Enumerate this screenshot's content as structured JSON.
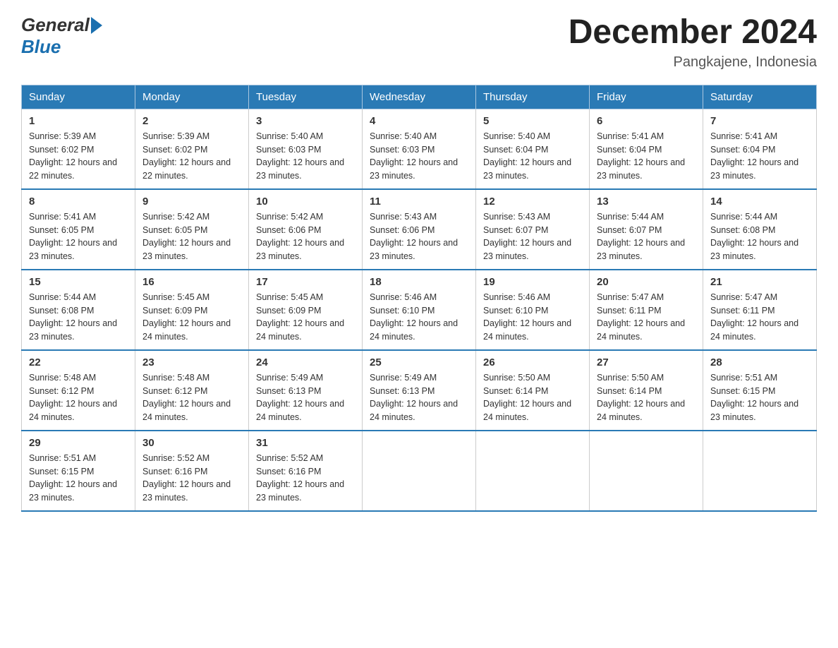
{
  "header": {
    "month_title": "December 2024",
    "location": "Pangkajene, Indonesia"
  },
  "logo": {
    "general": "General",
    "blue": "Blue"
  },
  "columns": [
    "Sunday",
    "Monday",
    "Tuesday",
    "Wednesday",
    "Thursday",
    "Friday",
    "Saturday"
  ],
  "weeks": [
    [
      {
        "day": "1",
        "sunrise": "Sunrise: 5:39 AM",
        "sunset": "Sunset: 6:02 PM",
        "daylight": "Daylight: 12 hours and 22 minutes."
      },
      {
        "day": "2",
        "sunrise": "Sunrise: 5:39 AM",
        "sunset": "Sunset: 6:02 PM",
        "daylight": "Daylight: 12 hours and 22 minutes."
      },
      {
        "day": "3",
        "sunrise": "Sunrise: 5:40 AM",
        "sunset": "Sunset: 6:03 PM",
        "daylight": "Daylight: 12 hours and 23 minutes."
      },
      {
        "day": "4",
        "sunrise": "Sunrise: 5:40 AM",
        "sunset": "Sunset: 6:03 PM",
        "daylight": "Daylight: 12 hours and 23 minutes."
      },
      {
        "day": "5",
        "sunrise": "Sunrise: 5:40 AM",
        "sunset": "Sunset: 6:04 PM",
        "daylight": "Daylight: 12 hours and 23 minutes."
      },
      {
        "day": "6",
        "sunrise": "Sunrise: 5:41 AM",
        "sunset": "Sunset: 6:04 PM",
        "daylight": "Daylight: 12 hours and 23 minutes."
      },
      {
        "day": "7",
        "sunrise": "Sunrise: 5:41 AM",
        "sunset": "Sunset: 6:04 PM",
        "daylight": "Daylight: 12 hours and 23 minutes."
      }
    ],
    [
      {
        "day": "8",
        "sunrise": "Sunrise: 5:41 AM",
        "sunset": "Sunset: 6:05 PM",
        "daylight": "Daylight: 12 hours and 23 minutes."
      },
      {
        "day": "9",
        "sunrise": "Sunrise: 5:42 AM",
        "sunset": "Sunset: 6:05 PM",
        "daylight": "Daylight: 12 hours and 23 minutes."
      },
      {
        "day": "10",
        "sunrise": "Sunrise: 5:42 AM",
        "sunset": "Sunset: 6:06 PM",
        "daylight": "Daylight: 12 hours and 23 minutes."
      },
      {
        "day": "11",
        "sunrise": "Sunrise: 5:43 AM",
        "sunset": "Sunset: 6:06 PM",
        "daylight": "Daylight: 12 hours and 23 minutes."
      },
      {
        "day": "12",
        "sunrise": "Sunrise: 5:43 AM",
        "sunset": "Sunset: 6:07 PM",
        "daylight": "Daylight: 12 hours and 23 minutes."
      },
      {
        "day": "13",
        "sunrise": "Sunrise: 5:44 AM",
        "sunset": "Sunset: 6:07 PM",
        "daylight": "Daylight: 12 hours and 23 minutes."
      },
      {
        "day": "14",
        "sunrise": "Sunrise: 5:44 AM",
        "sunset": "Sunset: 6:08 PM",
        "daylight": "Daylight: 12 hours and 23 minutes."
      }
    ],
    [
      {
        "day": "15",
        "sunrise": "Sunrise: 5:44 AM",
        "sunset": "Sunset: 6:08 PM",
        "daylight": "Daylight: 12 hours and 23 minutes."
      },
      {
        "day": "16",
        "sunrise": "Sunrise: 5:45 AM",
        "sunset": "Sunset: 6:09 PM",
        "daylight": "Daylight: 12 hours and 24 minutes."
      },
      {
        "day": "17",
        "sunrise": "Sunrise: 5:45 AM",
        "sunset": "Sunset: 6:09 PM",
        "daylight": "Daylight: 12 hours and 24 minutes."
      },
      {
        "day": "18",
        "sunrise": "Sunrise: 5:46 AM",
        "sunset": "Sunset: 6:10 PM",
        "daylight": "Daylight: 12 hours and 24 minutes."
      },
      {
        "day": "19",
        "sunrise": "Sunrise: 5:46 AM",
        "sunset": "Sunset: 6:10 PM",
        "daylight": "Daylight: 12 hours and 24 minutes."
      },
      {
        "day": "20",
        "sunrise": "Sunrise: 5:47 AM",
        "sunset": "Sunset: 6:11 PM",
        "daylight": "Daylight: 12 hours and 24 minutes."
      },
      {
        "day": "21",
        "sunrise": "Sunrise: 5:47 AM",
        "sunset": "Sunset: 6:11 PM",
        "daylight": "Daylight: 12 hours and 24 minutes."
      }
    ],
    [
      {
        "day": "22",
        "sunrise": "Sunrise: 5:48 AM",
        "sunset": "Sunset: 6:12 PM",
        "daylight": "Daylight: 12 hours and 24 minutes."
      },
      {
        "day": "23",
        "sunrise": "Sunrise: 5:48 AM",
        "sunset": "Sunset: 6:12 PM",
        "daylight": "Daylight: 12 hours and 24 minutes."
      },
      {
        "day": "24",
        "sunrise": "Sunrise: 5:49 AM",
        "sunset": "Sunset: 6:13 PM",
        "daylight": "Daylight: 12 hours and 24 minutes."
      },
      {
        "day": "25",
        "sunrise": "Sunrise: 5:49 AM",
        "sunset": "Sunset: 6:13 PM",
        "daylight": "Daylight: 12 hours and 24 minutes."
      },
      {
        "day": "26",
        "sunrise": "Sunrise: 5:50 AM",
        "sunset": "Sunset: 6:14 PM",
        "daylight": "Daylight: 12 hours and 24 minutes."
      },
      {
        "day": "27",
        "sunrise": "Sunrise: 5:50 AM",
        "sunset": "Sunset: 6:14 PM",
        "daylight": "Daylight: 12 hours and 24 minutes."
      },
      {
        "day": "28",
        "sunrise": "Sunrise: 5:51 AM",
        "sunset": "Sunset: 6:15 PM",
        "daylight": "Daylight: 12 hours and 23 minutes."
      }
    ],
    [
      {
        "day": "29",
        "sunrise": "Sunrise: 5:51 AM",
        "sunset": "Sunset: 6:15 PM",
        "daylight": "Daylight: 12 hours and 23 minutes."
      },
      {
        "day": "30",
        "sunrise": "Sunrise: 5:52 AM",
        "sunset": "Sunset: 6:16 PM",
        "daylight": "Daylight: 12 hours and 23 minutes."
      },
      {
        "day": "31",
        "sunrise": "Sunrise: 5:52 AM",
        "sunset": "Sunset: 6:16 PM",
        "daylight": "Daylight: 12 hours and 23 minutes."
      },
      null,
      null,
      null,
      null
    ]
  ]
}
